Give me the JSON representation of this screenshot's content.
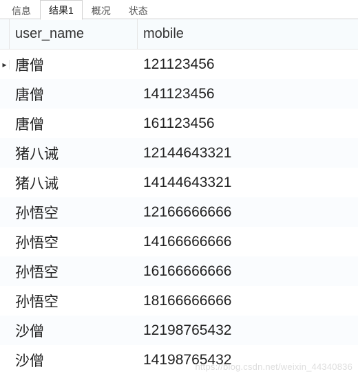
{
  "tabs": {
    "items": [
      {
        "label": "信息",
        "active": false
      },
      {
        "label": "结果1",
        "active": true
      },
      {
        "label": "概况",
        "active": false
      },
      {
        "label": "状态",
        "active": false
      }
    ]
  },
  "grid": {
    "columns": [
      {
        "label": "user_name"
      },
      {
        "label": "mobile"
      }
    ],
    "rows": [
      {
        "user_name": "唐僧",
        "mobile": "121123456",
        "current": true
      },
      {
        "user_name": "唐僧",
        "mobile": "141123456"
      },
      {
        "user_name": "唐僧",
        "mobile": "161123456"
      },
      {
        "user_name": "猪八诫",
        "mobile": "12144643321"
      },
      {
        "user_name": "猪八诫",
        "mobile": "14144643321"
      },
      {
        "user_name": "孙悟空",
        "mobile": "12166666666"
      },
      {
        "user_name": "孙悟空",
        "mobile": "14166666666"
      },
      {
        "user_name": "孙悟空",
        "mobile": "16166666666"
      },
      {
        "user_name": "孙悟空",
        "mobile": "18166666666"
      },
      {
        "user_name": "沙僧",
        "mobile": "12198765432"
      },
      {
        "user_name": "沙僧",
        "mobile": "14198765432"
      }
    ]
  },
  "watermark": "https://blog.csdn.net/weixin_44340836"
}
